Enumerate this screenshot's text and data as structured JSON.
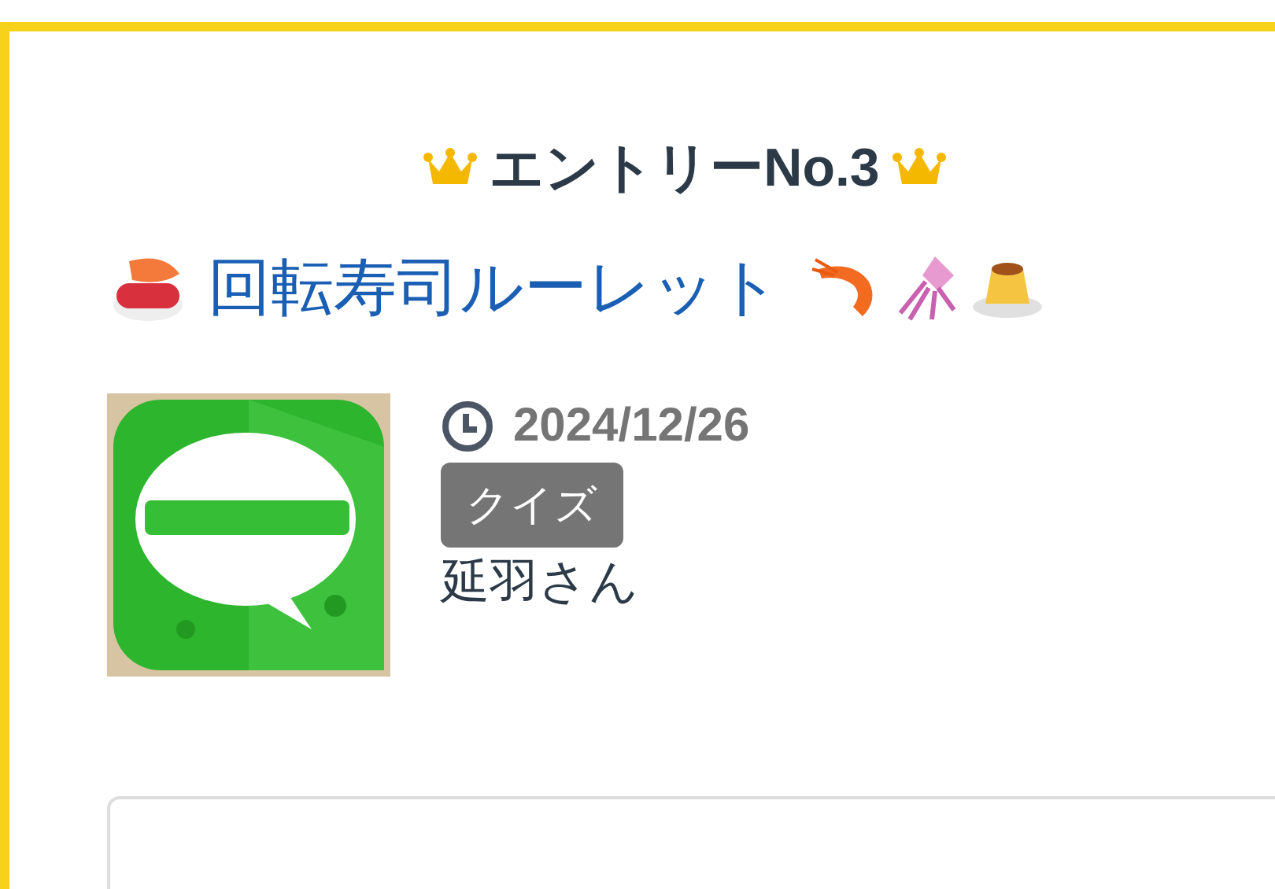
{
  "heading": "エントリーNo.3",
  "entry": {
    "title": "回転寿司ルーレット",
    "date": "2024/12/26",
    "category": "クイズ",
    "author": "延羽さん"
  }
}
